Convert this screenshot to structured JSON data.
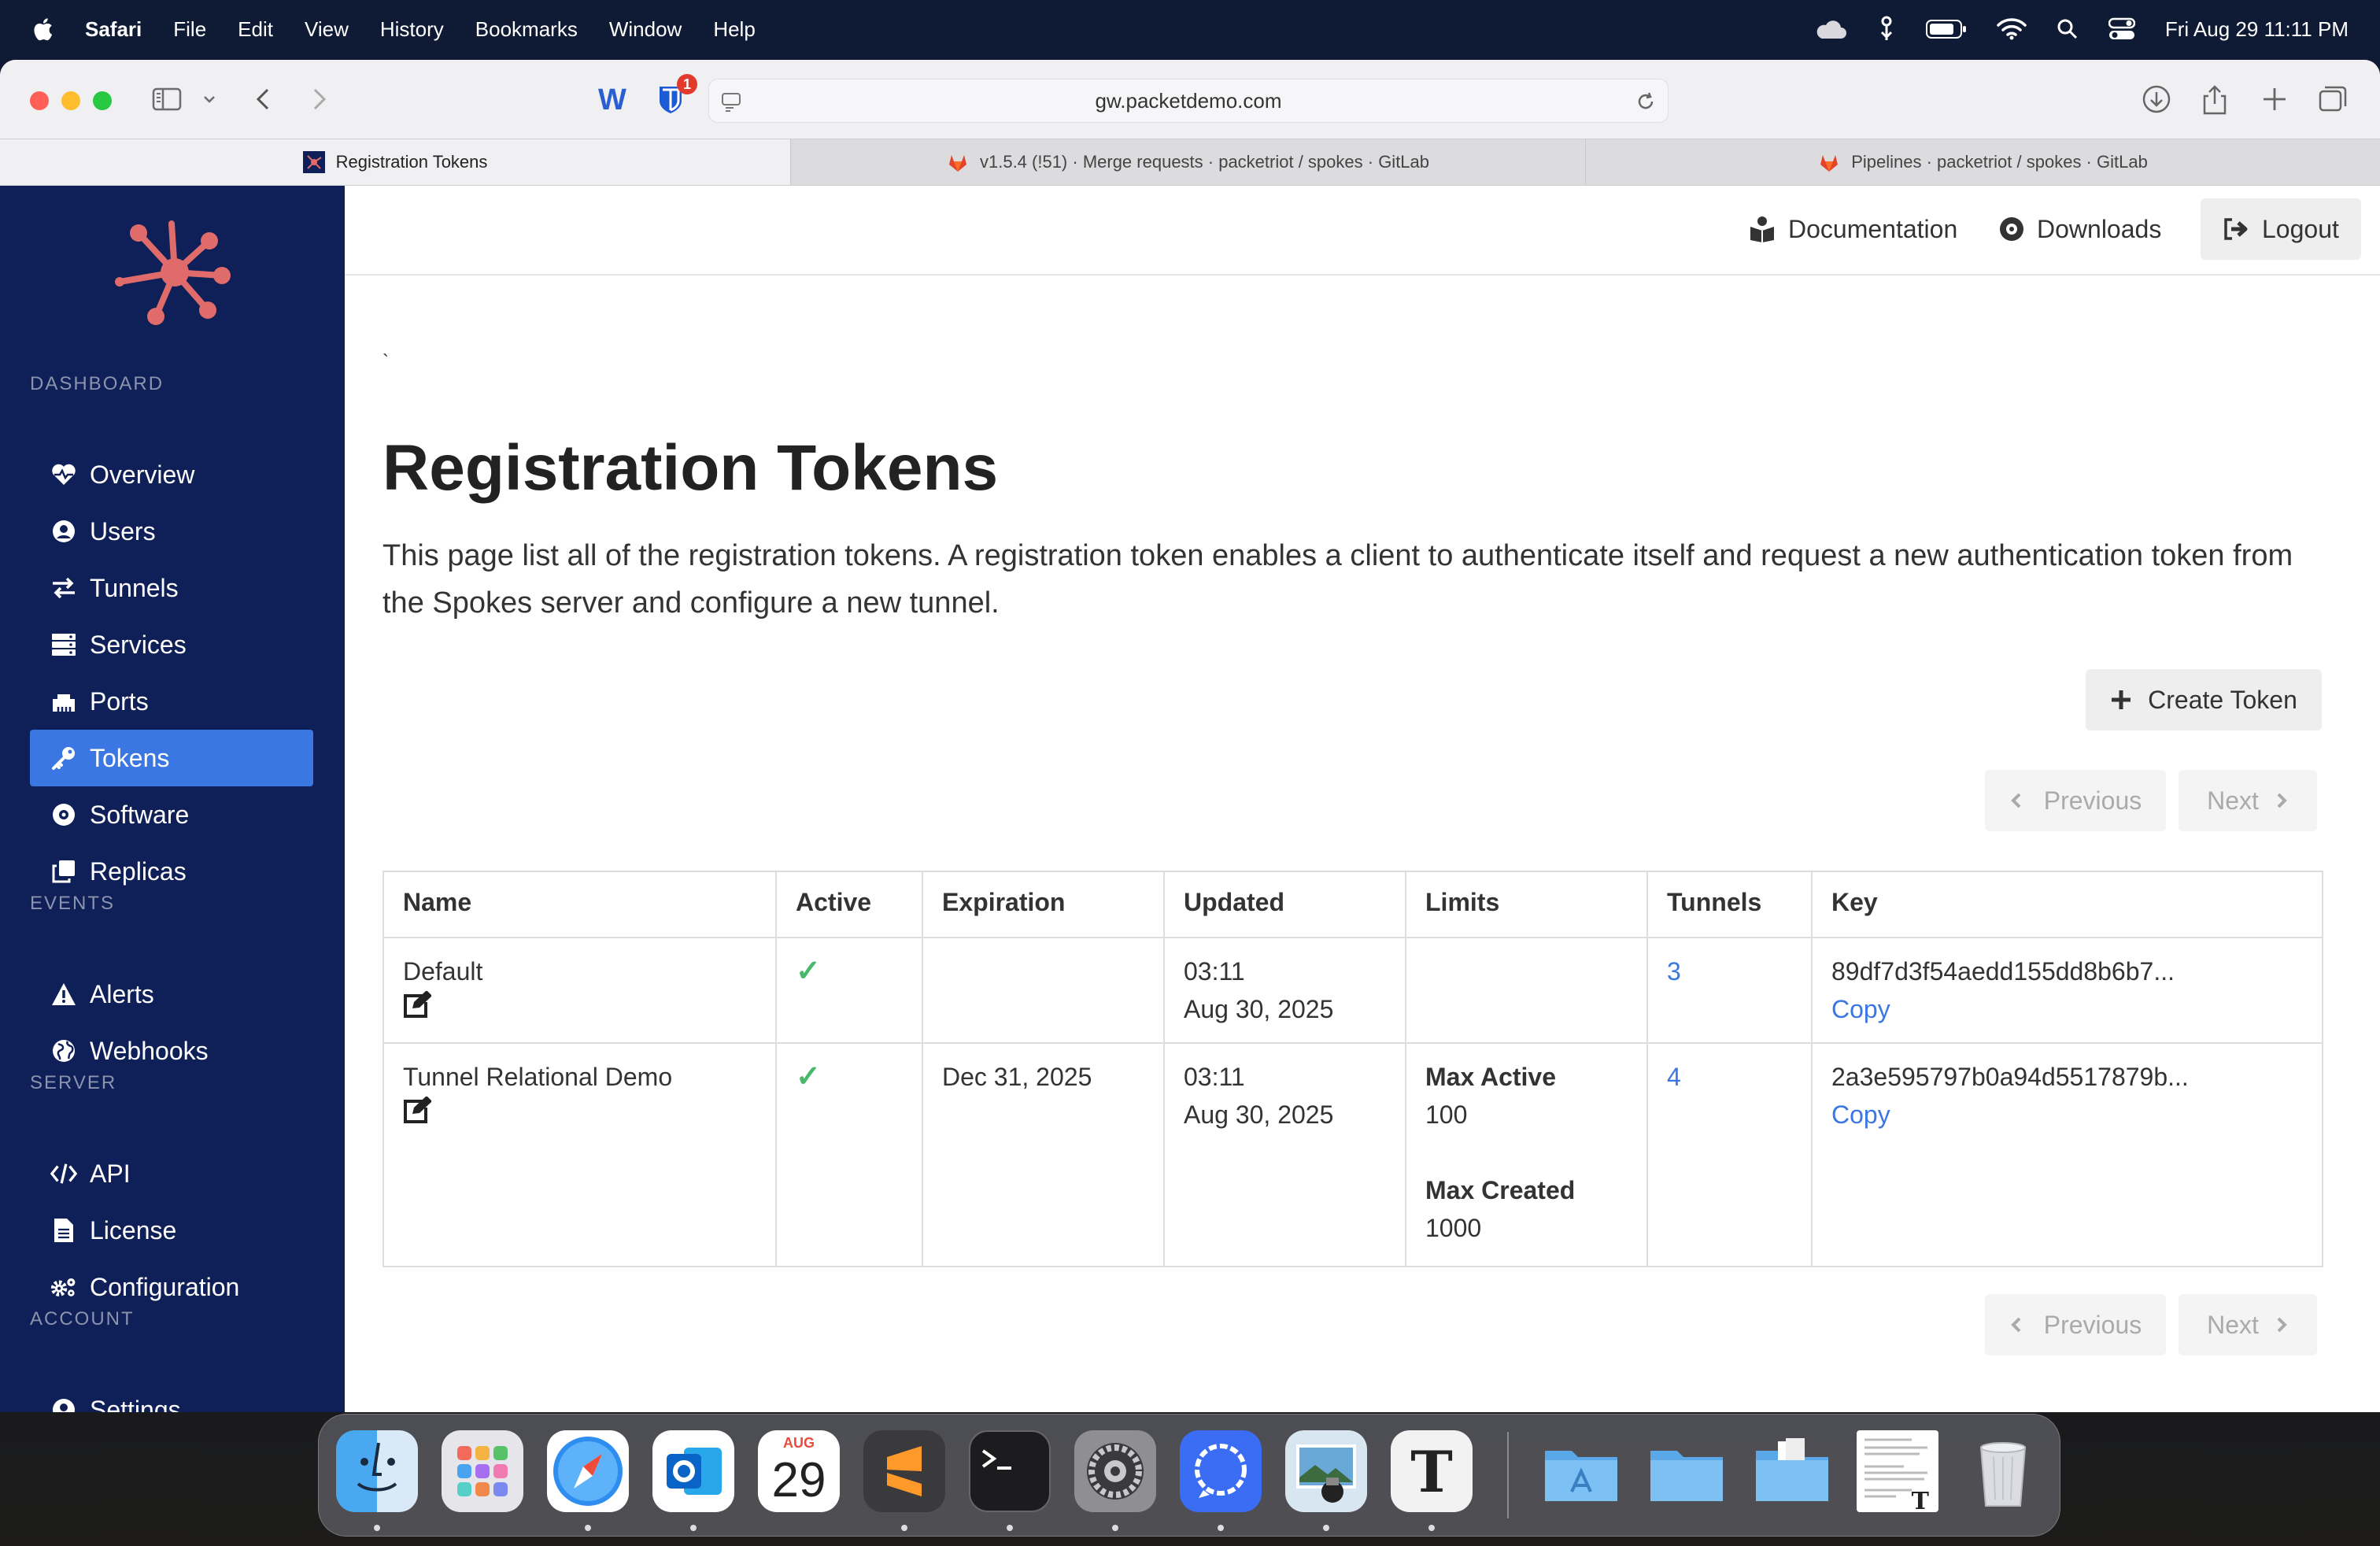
{
  "menubar": {
    "app": "Safari",
    "items": [
      "File",
      "Edit",
      "View",
      "History",
      "Bookmarks",
      "Window",
      "Help"
    ],
    "datetime": "Fri Aug 29  11:11 PM",
    "icons": [
      "apple-icon",
      "cloud-icon",
      "rain-drop-icon",
      "battery-icon",
      "wifi-icon",
      "search-icon",
      "control-center-icon"
    ]
  },
  "browser": {
    "address": "gw.packetdemo.com",
    "badge_count": "1",
    "tabs": [
      {
        "label": "Registration Tokens",
        "active": true
      },
      {
        "label": "v1.5.4 (!51) · Merge requests · packetriot / spokes · GitLab",
        "active": false
      },
      {
        "label": "Pipelines · packetriot / spokes · GitLab",
        "active": false
      }
    ]
  },
  "sidebar": {
    "sections": [
      {
        "title": "DASHBOARD",
        "items": [
          "Overview",
          "Users",
          "Tunnels",
          "Services",
          "Ports",
          "Tokens",
          "Software",
          "Replicas"
        ]
      },
      {
        "title": "EVENTS",
        "items": [
          "Alerts",
          "Webhooks"
        ]
      },
      {
        "title": "SERVER",
        "items": [
          "API",
          "License",
          "Configuration"
        ]
      },
      {
        "title": "ACCOUNT",
        "items": [
          "Settings"
        ]
      }
    ],
    "active": "Tokens",
    "accent": "#3b77e3",
    "background": "#0f1f57"
  },
  "topnav": {
    "documentation": "Documentation",
    "downloads": "Downloads",
    "logout": "Logout"
  },
  "page": {
    "tick": "`",
    "title": "Registration Tokens",
    "description": "This page list all of the registration tokens. A registration token enables a client to authenticate itself and request a new authentication token from the Spokes server and configure a new tunnel.",
    "create_label": "Create Token",
    "prev_label": "Previous",
    "next_label": "Next"
  },
  "table": {
    "headers": [
      "Name",
      "Active",
      "Expiration",
      "Updated",
      "Limits",
      "Tunnels",
      "Key"
    ],
    "rows": [
      {
        "name": "Default",
        "active": "✓",
        "expiration": "",
        "updated_time": "03:11",
        "updated_date": "Aug 30, 2025",
        "limits": [],
        "tunnels": "3",
        "key": "89df7d3f54aedd155dd8b6b7...",
        "copy": "Copy"
      },
      {
        "name": "Tunnel Relational Demo",
        "active": "✓",
        "expiration": "Dec 31, 2025",
        "updated_time": "03:11",
        "updated_date": "Aug 30, 2025",
        "limits": [
          {
            "label": "Max Active",
            "value": "100"
          },
          {
            "label": "Max Created",
            "value": "1000"
          }
        ],
        "tunnels": "4",
        "key": "2a3e595797b0a94d5517879b...",
        "copy": "Copy"
      }
    ]
  },
  "dock": {
    "calendar_month": "AUG",
    "calendar_day": "29",
    "apps": [
      "finder-icon",
      "launchpad-icon",
      "safari-icon",
      "outlook-icon",
      "calendar-icon",
      "sublime-text-icon",
      "terminal-icon",
      "system-settings-icon",
      "signal-icon",
      "preview-icon",
      "typora-icon",
      "applications-folder-icon",
      "folder-icon",
      "documents-folder-icon",
      "document-thumbnail-icon",
      "trash-icon"
    ]
  }
}
